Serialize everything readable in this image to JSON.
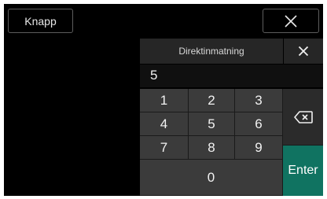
{
  "header": {
    "knapp_label": "Knapp",
    "close_icon": "close-icon"
  },
  "input_dialog": {
    "title": "Direktinmatning",
    "close_icon": "close-icon",
    "value": "5",
    "keys": {
      "k1": "1",
      "k2": "2",
      "k3": "3",
      "k4": "4",
      "k5": "5",
      "k6": "6",
      "k7": "7",
      "k8": "8",
      "k9": "9",
      "k0": "0"
    },
    "backspace_icon": "backspace-icon",
    "enter_label": "Enter",
    "colors": {
      "enter_bg": "#107361",
      "key_bg": "#3b3b3b",
      "side_bg": "#2b2b2b"
    }
  }
}
